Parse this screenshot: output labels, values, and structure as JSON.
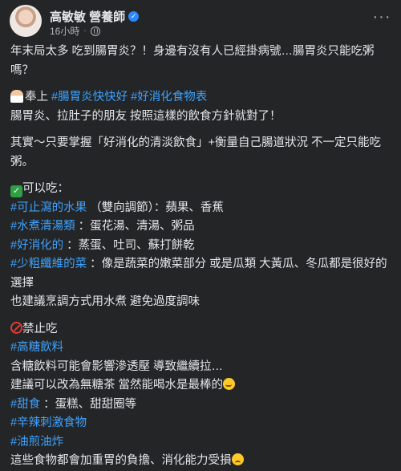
{
  "author": {
    "name": "高敏敏 營養師",
    "time": "16小時",
    "more_label": "···"
  },
  "post": {
    "lines": [
      "年末局太多 吃到腸胃炎？！身邊有沒有人已經掛病號…腸胃炎只能吃粥嗎？",
      "奉上",
      "#腸胃炎快快好",
      "#好消化食物表",
      "腸胃炎、拉肚子的朋友 按照這樣的飲食方針就對了！",
      "其實～只要掌握「好消化的清淡飲食」+衡量自己腸道狀況 不一定只能吃粥。",
      "可以吃：",
      "#可止瀉的水果",
      "（雙向調節）：蘋果、香蕉",
      "#水煮清湯類",
      "：蛋花湯、清湯、粥品",
      "#好消化的",
      "：蒸蛋、吐司、蘇打餅乾",
      "#少粗纖維的菜",
      "：像是蔬菜的嫩菜部分 或是瓜類 大黃瓜、冬瓜都是很好的選擇",
      "也建議烹調方式用水煮 避免過度調味",
      "禁止吃",
      "#高糖飲料",
      "含糖飲料可能會影響滲透壓 導致繼續拉…",
      "建議可以改為無糖茶 當然能喝水是最棒的",
      "#甜食",
      "：蛋糕、甜甜圈等",
      "#辛辣刺激食物",
      "#油煎油炸",
      "這些食物都會加重胃的負擔、消化能力受損"
    ]
  },
  "icons": [
    "verified-badge-icon",
    "globe-icon",
    "more-options-icon",
    "doctor-emoji-icon",
    "check-mark-emoji-icon",
    "prohibited-emoji-icon",
    "smiling-emoji-icon",
    "sad-emoji-icon"
  ],
  "colors": {
    "background": "#242526",
    "text": "#e4e6eb",
    "hashtag": "#3ea2ff",
    "meta": "#b0b3b8"
  }
}
